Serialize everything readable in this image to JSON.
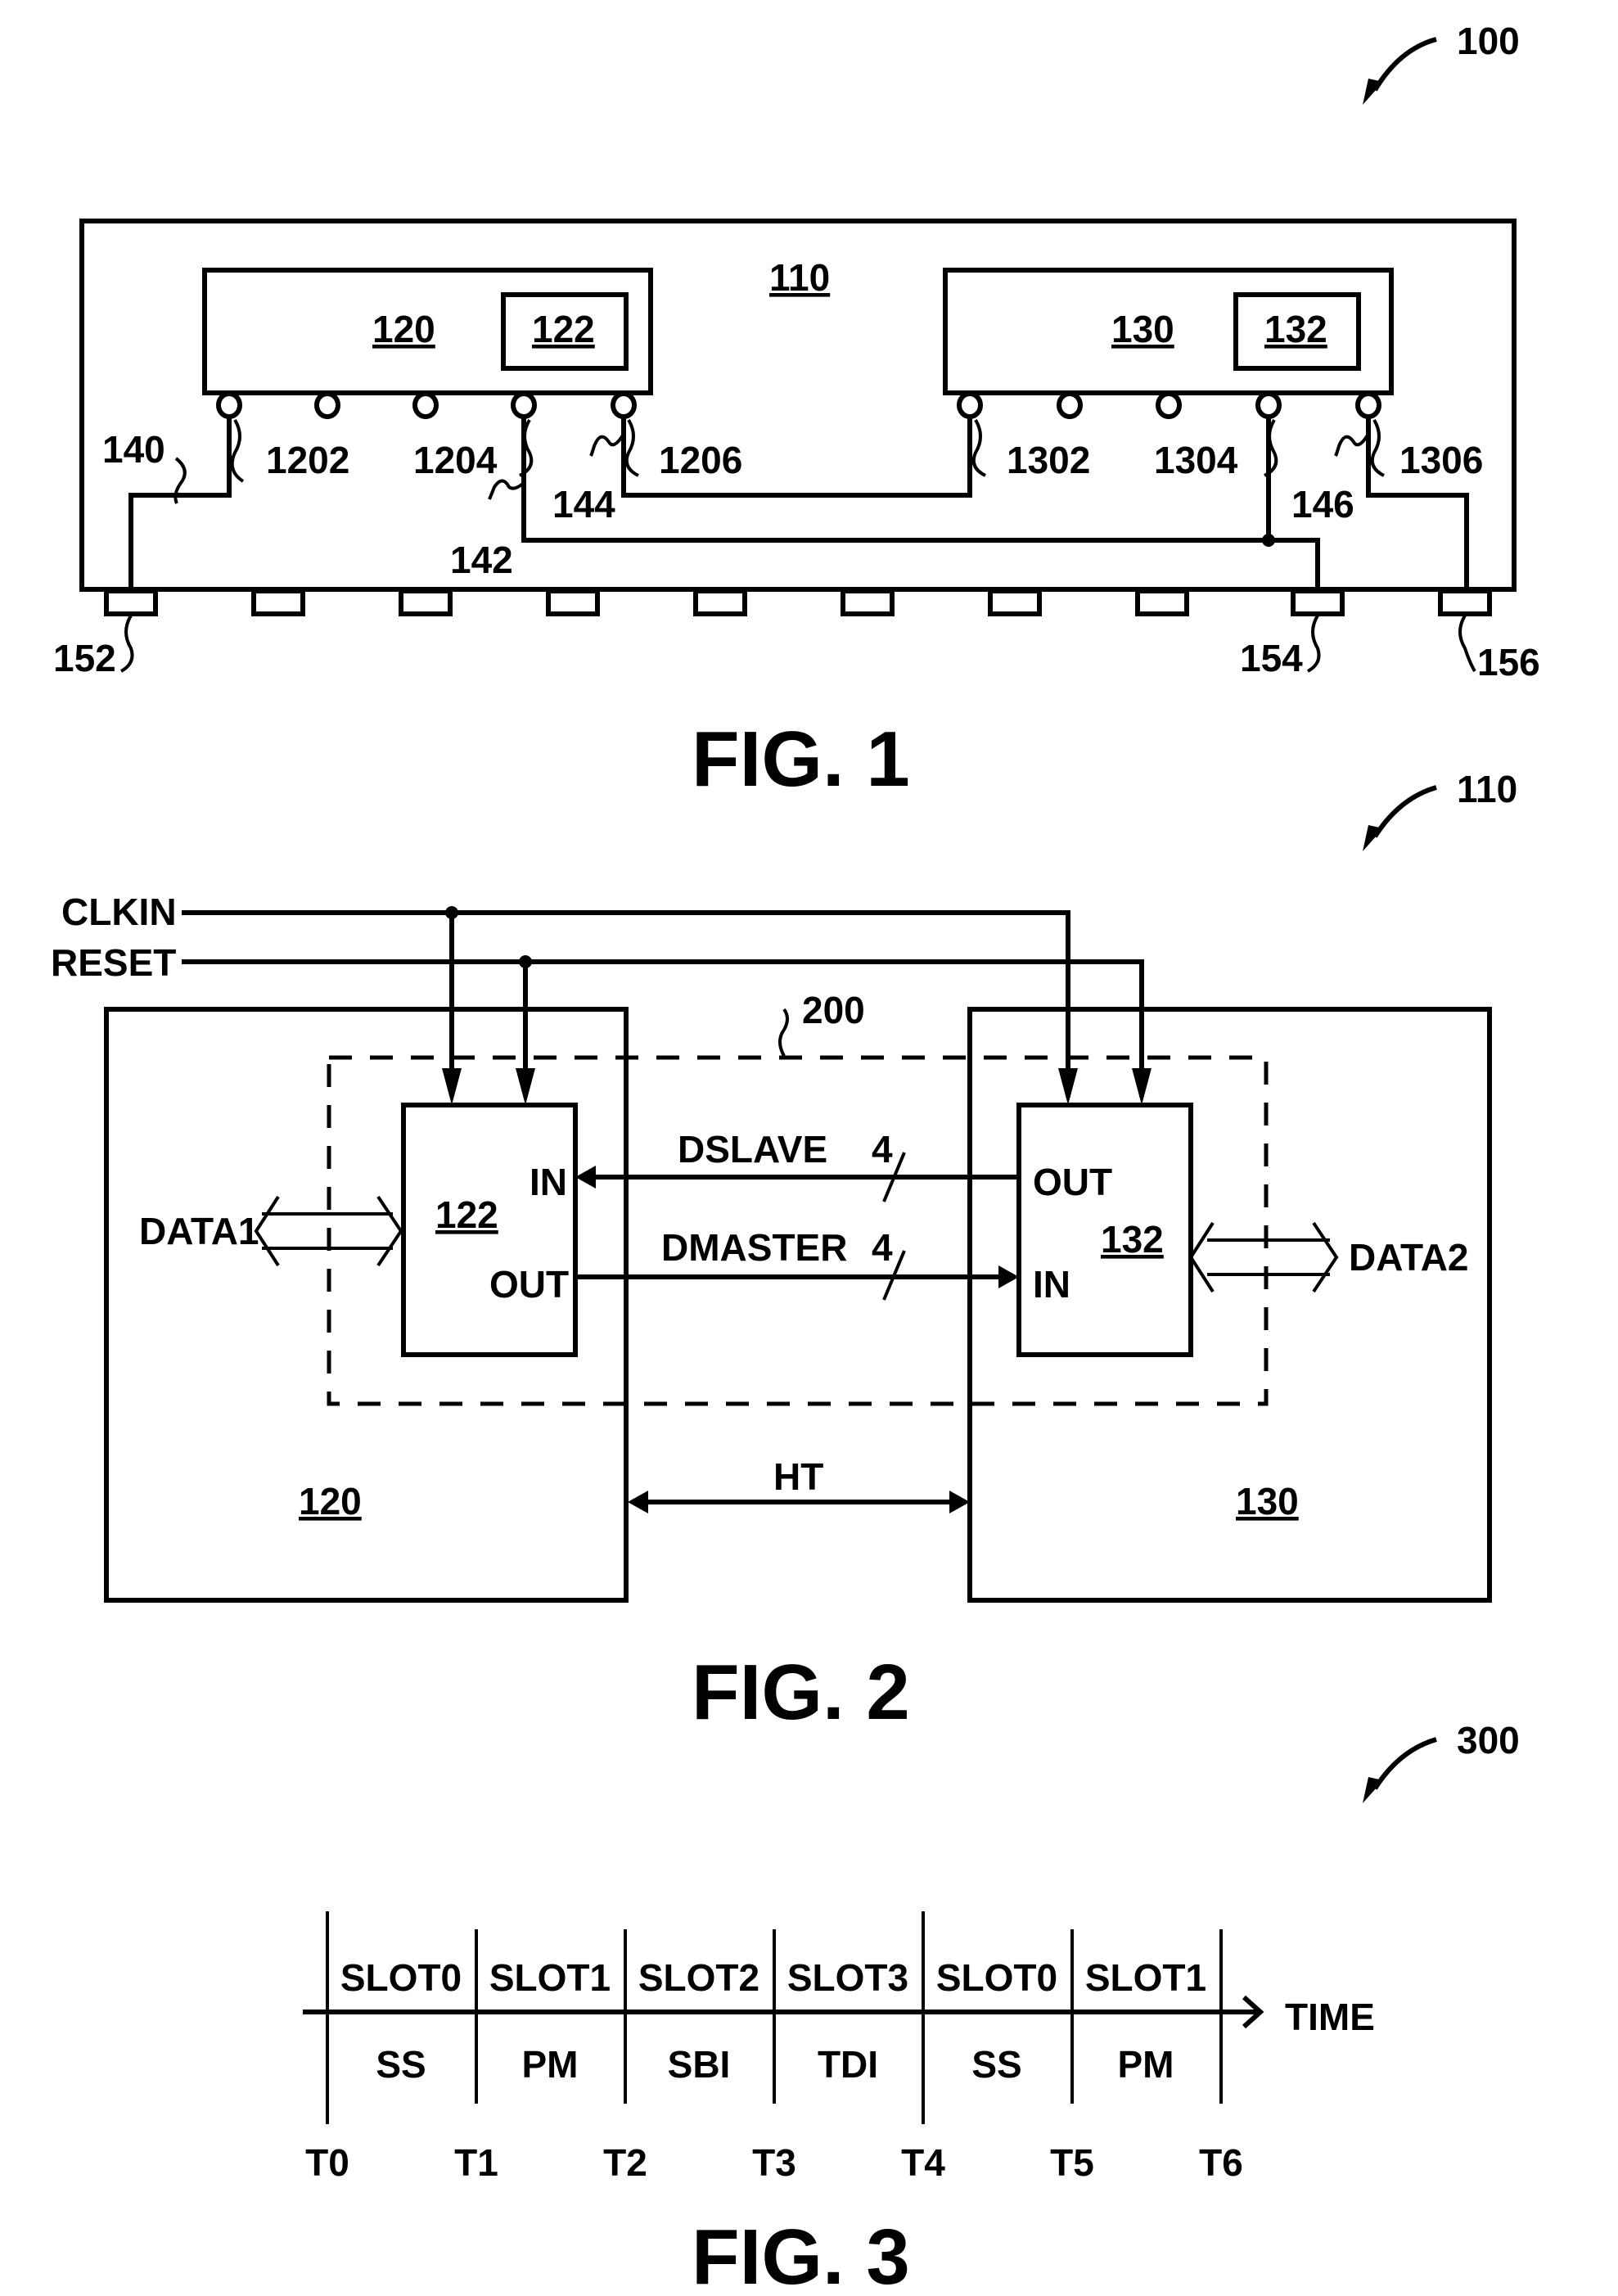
{
  "fig1": {
    "ref": "100",
    "caption": "FIG. 1",
    "package": "110",
    "die1": "120",
    "die1_block": "122",
    "die2": "130",
    "die2_block": "132",
    "pins1": [
      "1202",
      "1204",
      "1206"
    ],
    "pins2": [
      "1302",
      "1304",
      "1306"
    ],
    "traces": [
      "140",
      "142",
      "144",
      "146"
    ],
    "pads": [
      "152",
      "154",
      "156"
    ]
  },
  "fig2": {
    "ref": "110",
    "caption": "FIG. 2",
    "clkin": "CLKIN",
    "reset": "RESET",
    "group": "200",
    "die1": "120",
    "die2": "130",
    "block1": "122",
    "block2": "132",
    "in": "IN",
    "out": "OUT",
    "dslave": "DSLAVE",
    "dmaster": "DMASTER",
    "width": "4",
    "data1": "DATA1",
    "data2": "DATA2",
    "ht": "HT"
  },
  "fig3": {
    "ref": "300",
    "caption": "FIG. 3",
    "time": "TIME",
    "slots": [
      "SLOT0",
      "SLOT1",
      "SLOT2",
      "SLOT3",
      "SLOT0",
      "SLOT1"
    ],
    "phases": [
      "SS",
      "PM",
      "SBI",
      "TDI",
      "SS",
      "PM"
    ],
    "ticks": [
      "T0",
      "T1",
      "T2",
      "T3",
      "T4",
      "T5",
      "T6"
    ]
  }
}
